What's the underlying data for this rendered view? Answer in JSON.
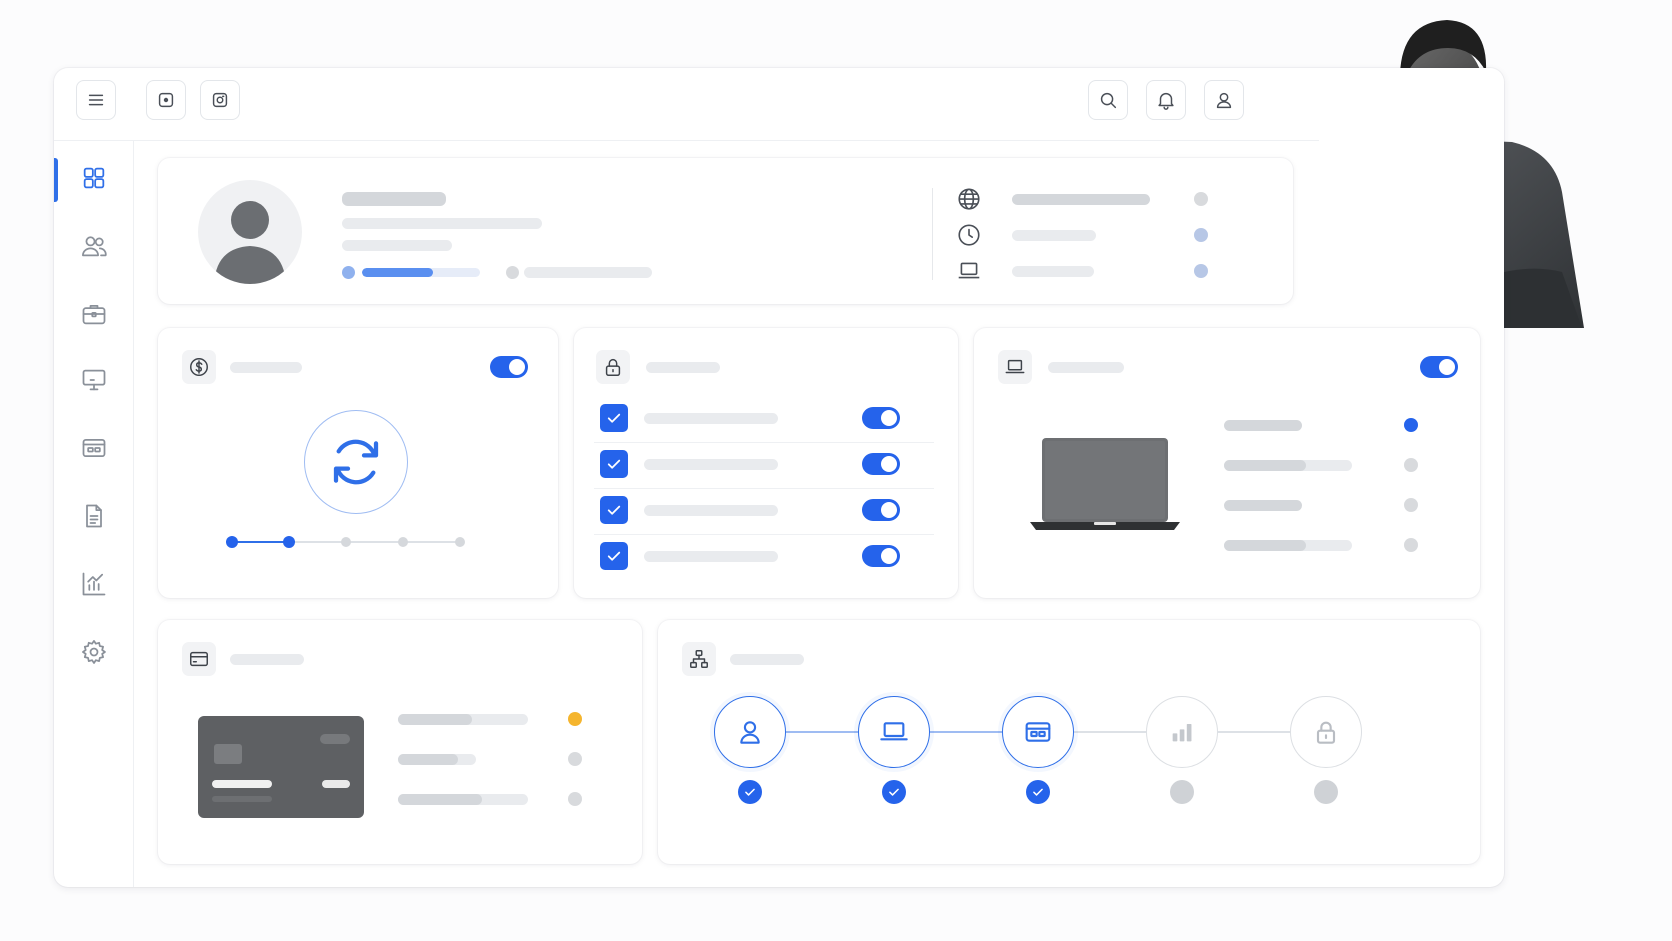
{
  "app": {
    "accent": "#2563eb"
  },
  "topbar": {
    "left_icons": [
      "menu-icon",
      "record-icon",
      "capture-icon"
    ],
    "right_icons": [
      "search-icon",
      "bell-icon",
      "user-icon"
    ]
  },
  "sidebar": {
    "items": [
      {
        "icon": "dashboard-grid-icon",
        "active": true
      },
      {
        "icon": "users-icon",
        "active": false
      },
      {
        "icon": "briefcase-icon",
        "active": false
      },
      {
        "icon": "monitor-icon",
        "active": false
      },
      {
        "icon": "payment-card-icon",
        "active": false
      },
      {
        "icon": "document-icon",
        "active": false
      },
      {
        "icon": "analytics-icon",
        "active": false
      },
      {
        "icon": "settings-icon",
        "active": false
      }
    ]
  },
  "profile_card": {
    "avatar": "avatar-placeholder",
    "progress_fraction": 0.6,
    "info_icons": [
      "globe-icon",
      "clock-icon",
      "laptop-icon"
    ],
    "status_colors": [
      "#d8dadd",
      "#b7c7e6",
      "#b7c7e6"
    ]
  },
  "sync_card": {
    "header_icon": "dollar-icon",
    "toggle_on": true,
    "center_icon": "sync-icon",
    "steps_total": 5,
    "steps_completed": 2
  },
  "security_card": {
    "header_icon": "lock-icon",
    "rows": [
      {
        "checked": true,
        "toggle_on": true
      },
      {
        "checked": true,
        "toggle_on": true
      },
      {
        "checked": true,
        "toggle_on": true
      },
      {
        "checked": true,
        "toggle_on": true
      }
    ]
  },
  "device_card": {
    "header_icon": "laptop-icon",
    "toggle_on": true,
    "status_colors": [
      "#2563eb",
      "#d8dadd",
      "#d8dadd",
      "#d8dadd"
    ]
  },
  "payment_card": {
    "header_icon": "credit-card-icon",
    "status_colors": [
      "#f5b52e",
      "#d8dadd",
      "#d8dadd"
    ]
  },
  "workflow_card": {
    "header_icon": "hierarchy-icon",
    "steps": [
      {
        "icon": "user-icon",
        "done": true
      },
      {
        "icon": "laptop-icon",
        "done": true
      },
      {
        "icon": "payment-card-icon",
        "done": true
      },
      {
        "icon": "bar-chart-icon",
        "done": false
      },
      {
        "icon": "lock-icon",
        "done": false
      }
    ]
  },
  "photo": {
    "subject": "man-working-on-laptop-photo"
  }
}
